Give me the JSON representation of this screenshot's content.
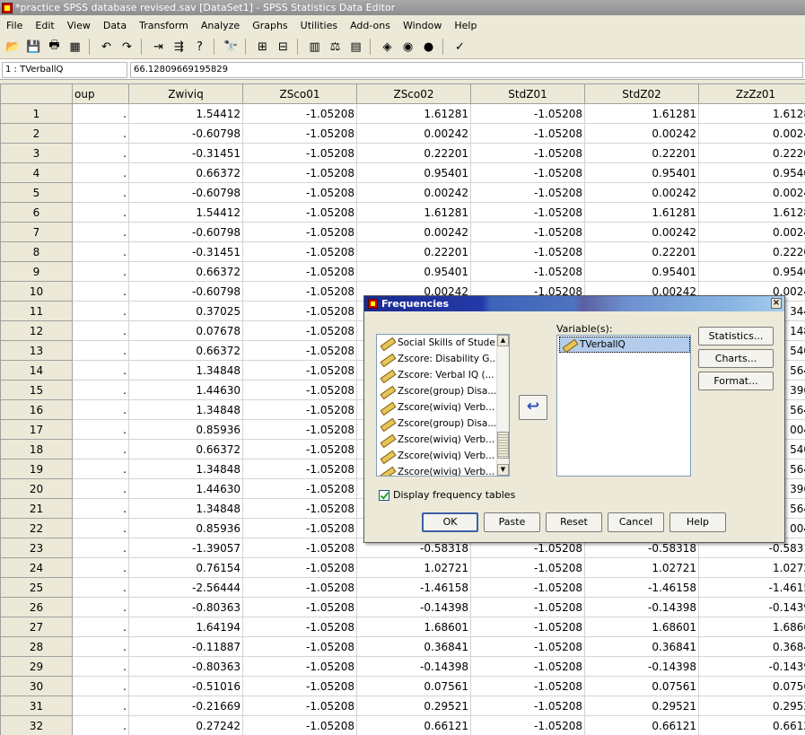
{
  "window": {
    "title": "*practice SPSS database revised.sav [DataSet1] - SPSS Statistics Data Editor"
  },
  "menu": [
    "File",
    "Edit",
    "View",
    "Data",
    "Transform",
    "Analyze",
    "Graphs",
    "Utilities",
    "Add-ons",
    "Window",
    "Help"
  ],
  "toolbar": {
    "icons": [
      "open-icon",
      "save-icon",
      "print-icon",
      "dialog-recall-icon",
      "undo-icon",
      "redo-icon",
      "goto-case-icon",
      "goto-variable-icon",
      "variables-icon",
      "find-icon",
      "insert-cases-icon",
      "insert-variable-icon",
      "split-file-icon",
      "weight-cases-icon",
      "select-cases-icon",
      "value-labels-icon",
      "use-sets-icon",
      "show-all-icon",
      "spelling-icon"
    ]
  },
  "cell_editor": {
    "ref": "1 : TVerballQ",
    "value": "66.12809669195829"
  },
  "grid": {
    "columns": [
      "oup",
      "Zwiviq",
      "ZSco01",
      "ZSco02",
      "StdZ01",
      "StdZ02",
      "ZzZz01"
    ],
    "rows": [
      [
        "1",
        ".",
        "1.54412",
        "-1.05208",
        "1.61281",
        "-1.05208",
        "1.61281",
        "1.6128"
      ],
      [
        "2",
        ".",
        "-0.60798",
        "-1.05208",
        "0.00242",
        "-1.05208",
        "0.00242",
        "0.0024"
      ],
      [
        "3",
        ".",
        "-0.31451",
        "-1.05208",
        "0.22201",
        "-1.05208",
        "0.22201",
        "0.2220"
      ],
      [
        "4",
        ".",
        "0.66372",
        "-1.05208",
        "0.95401",
        "-1.05208",
        "0.95401",
        "0.9540"
      ],
      [
        "5",
        ".",
        "-0.60798",
        "-1.05208",
        "0.00242",
        "-1.05208",
        "0.00242",
        "0.0024"
      ],
      [
        "6",
        ".",
        "1.54412",
        "-1.05208",
        "1.61281",
        "-1.05208",
        "1.61281",
        "1.6128"
      ],
      [
        "7",
        ".",
        "-0.60798",
        "-1.05208",
        "0.00242",
        "-1.05208",
        "0.00242",
        "0.0024"
      ],
      [
        "8",
        ".",
        "-0.31451",
        "-1.05208",
        "0.22201",
        "-1.05208",
        "0.22201",
        "0.2220"
      ],
      [
        "9",
        ".",
        "0.66372",
        "-1.05208",
        "0.95401",
        "-1.05208",
        "0.95401",
        "0.9540"
      ],
      [
        "10",
        ".",
        "-0.60798",
        "-1.05208",
        "0.00242",
        "-1.05208",
        "0.00242",
        "0.0024"
      ],
      [
        "11",
        ".",
        "0.37025",
        "-1.05208",
        "",
        "",
        "",
        "344"
      ],
      [
        "12",
        ".",
        "0.07678",
        "-1.05208",
        "",
        "",
        "",
        "148"
      ],
      [
        "13",
        ".",
        "0.66372",
        "-1.05208",
        "",
        "",
        "",
        "540"
      ],
      [
        "14",
        ".",
        "1.34848",
        "-1.05208",
        "",
        "",
        "",
        "564"
      ],
      [
        "15",
        ".",
        "1.44630",
        "-1.05208",
        "",
        "",
        "",
        "396"
      ],
      [
        "16",
        ".",
        "1.34848",
        "-1.05208",
        "",
        "",
        "",
        "564"
      ],
      [
        "17",
        ".",
        "0.85936",
        "-1.05208",
        "",
        "",
        "",
        "004"
      ],
      [
        "18",
        ".",
        "0.66372",
        "-1.05208",
        "",
        "",
        "",
        "540"
      ],
      [
        "19",
        ".",
        "1.34848",
        "-1.05208",
        "",
        "",
        "",
        "564"
      ],
      [
        "20",
        ".",
        "1.44630",
        "-1.05208",
        "",
        "",
        "",
        "396"
      ],
      [
        "21",
        ".",
        "1.34848",
        "-1.05208",
        "",
        "",
        "",
        "564"
      ],
      [
        "22",
        ".",
        "0.85936",
        "-1.05208",
        "",
        "",
        "",
        "004"
      ],
      [
        "23",
        ".",
        "-1.39057",
        "-1.05208",
        "-0.58318",
        "-1.05208",
        "-0.58318",
        "-0.5831"
      ],
      [
        "24",
        ".",
        "0.76154",
        "-1.05208",
        "1.02721",
        "-1.05208",
        "1.02721",
        "1.0272"
      ],
      [
        "25",
        ".",
        "-2.56444",
        "-1.05208",
        "-1.46158",
        "-1.05208",
        "-1.46158",
        "-1.4615"
      ],
      [
        "26",
        ".",
        "-0.80363",
        "-1.05208",
        "-0.14398",
        "-1.05208",
        "-0.14398",
        "-0.1439"
      ],
      [
        "27",
        ".",
        "1.64194",
        "-1.05208",
        "1.68601",
        "-1.05208",
        "1.68601",
        "1.6860"
      ],
      [
        "28",
        ".",
        "-0.11887",
        "-1.05208",
        "0.36841",
        "-1.05208",
        "0.36841",
        "0.3684"
      ],
      [
        "29",
        ".",
        "-0.80363",
        "-1.05208",
        "-0.14398",
        "-1.05208",
        "-0.14398",
        "-0.1439"
      ],
      [
        "30",
        ".",
        "-0.51016",
        "-1.05208",
        "0.07561",
        "-1.05208",
        "0.07561",
        "0.0756"
      ],
      [
        "31",
        ".",
        "-0.21669",
        "-1.05208",
        "0.29521",
        "-1.05208",
        "0.29521",
        "0.2952"
      ],
      [
        "32",
        ".",
        "0.27242",
        "-1.05208",
        "0.66121",
        "-1.05208",
        "0.66121",
        "0.6612"
      ]
    ]
  },
  "dialog": {
    "title": "Frequencies",
    "source_items": [
      "Social Skills of Stude...",
      "Zscore:  Disability G...",
      "Zscore:  Verbal IQ (...",
      "Zscore(group)  Disa...",
      "Zscore(wiviq)  Verb...",
      "Zscore(group)  Disa...",
      "Zscore(wiviq)  Verb...",
      "Zscore(wiviq)  Verb...",
      "Zscore(wiviq)  Verb..."
    ],
    "variables_label": "Variable(s):",
    "selected_variables": [
      "TVerballQ"
    ],
    "side_buttons": [
      "Statistics...",
      "Charts...",
      "Format..."
    ],
    "checkbox_label": "Display frequency tables",
    "checkbox_checked": true,
    "bottom_buttons": [
      "OK",
      "Paste",
      "Reset",
      "Cancel",
      "Help"
    ]
  }
}
